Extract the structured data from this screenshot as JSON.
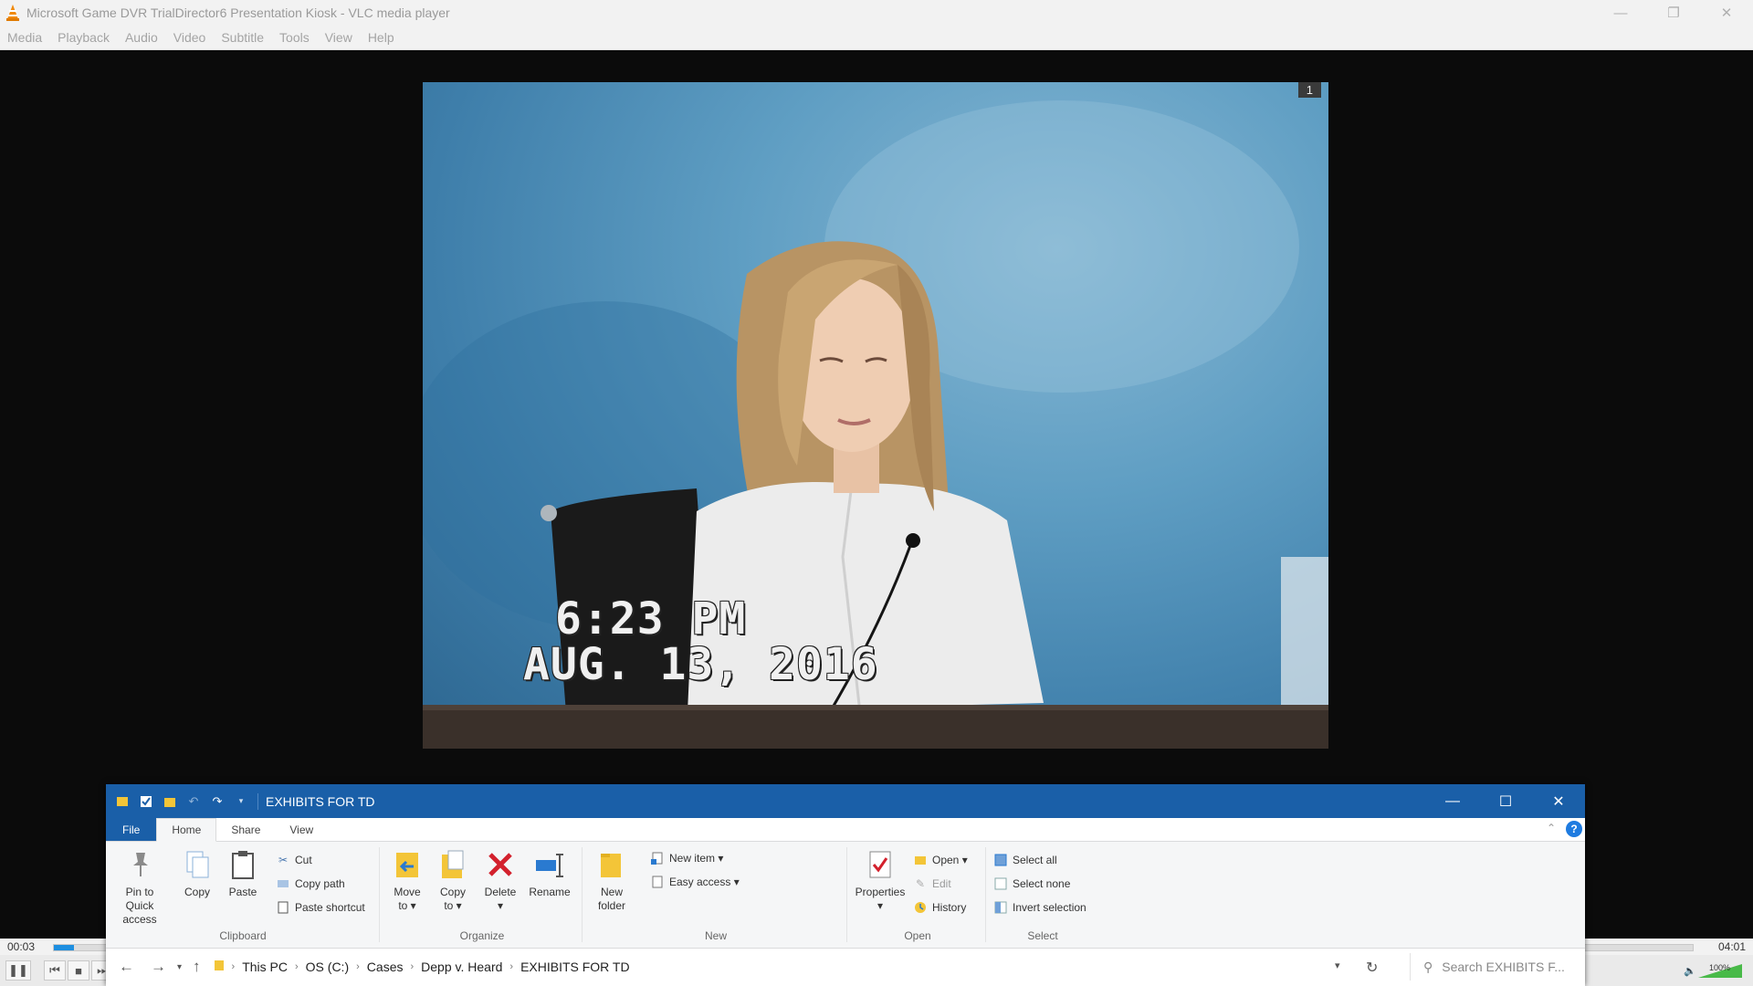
{
  "vlc": {
    "window_title": "Microsoft Game DVR   TrialDirector6 Presentation Kiosk - VLC media player",
    "menu": [
      "Media",
      "Playback",
      "Audio",
      "Video",
      "Subtitle",
      "Tools",
      "View",
      "Help"
    ],
    "time_current": "00:03",
    "time_total": "04:01",
    "progress": 0.012,
    "volume": "100%"
  },
  "video": {
    "frame_number": "1",
    "timestamp_time": "6:23 PM",
    "timestamp_date": "AUG. 13, 2016"
  },
  "explorer": {
    "title": "EXHIBITS FOR TD",
    "tabs": {
      "file": "File",
      "home": "Home",
      "share": "Share",
      "view": "View"
    },
    "clipboard": {
      "label": "Clipboard",
      "pin": "Pin to Quick access",
      "copy": "Copy",
      "paste": "Paste",
      "cut": "Cut",
      "copy_path": "Copy path",
      "paste_shortcut": "Paste shortcut"
    },
    "organize": {
      "label": "Organize",
      "move_to": "Move to",
      "copy_to": "Copy to",
      "delete": "Delete",
      "rename": "Rename"
    },
    "new": {
      "label": "New",
      "new_folder": "New folder",
      "new_item": "New item",
      "easy_access": "Easy access"
    },
    "open": {
      "label": "Open",
      "properties": "Properties",
      "open": "Open",
      "edit": "Edit",
      "history": "History"
    },
    "select": {
      "label": "Select",
      "select_all": "Select all",
      "select_none": "Select none",
      "invert": "Invert selection"
    },
    "breadcrumb": [
      "This PC",
      "OS (C:)",
      "Cases",
      "Depp v. Heard",
      "EXHIBITS FOR TD"
    ],
    "search_placeholder": "Search EXHIBITS F..."
  },
  "colors": {
    "explorer_accent": "#1a5fa8",
    "vlc_progress": "#1e8fe0",
    "delete_red": "#d3212d",
    "folder_yellow": "#f3c538"
  }
}
